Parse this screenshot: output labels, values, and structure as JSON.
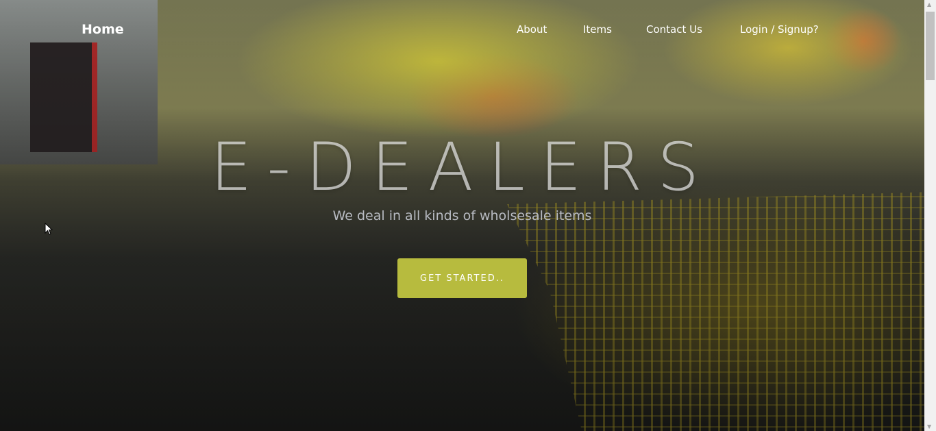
{
  "nav": {
    "home": "Home",
    "items": [
      "About",
      "Items",
      "Contact Us",
      "Login / Signup?"
    ]
  },
  "hero": {
    "title": "E-DEALERS",
    "tagline": "We deal in all kinds of wholsesale items",
    "cta": "GET STARTED.."
  },
  "colors": {
    "accent": "#b7bb3e"
  }
}
